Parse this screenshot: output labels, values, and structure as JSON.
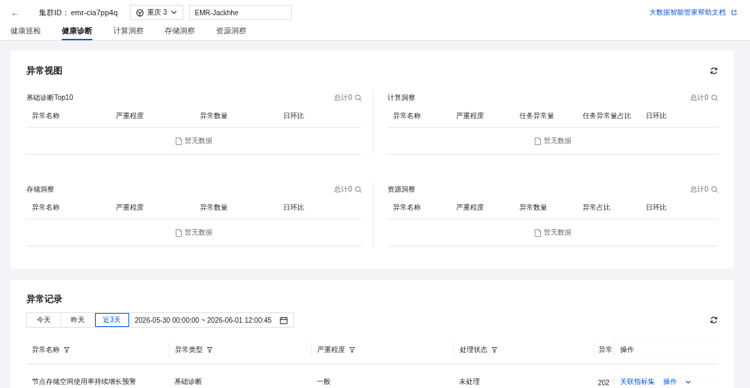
{
  "header": {
    "back": "←",
    "cluster_label": "集群ID：",
    "cluster_id": "emr-cia7pp4q",
    "region": "重庆 3",
    "cluster_name": "EMR-Jackhhe",
    "help_link": "大数据智能管家帮助文档"
  },
  "tabs": [
    {
      "label": "健康巡检",
      "selected": false
    },
    {
      "label": "健康诊断",
      "selected": true
    },
    {
      "label": "计算洞察",
      "selected": false
    },
    {
      "label": "存储洞察",
      "selected": false
    },
    {
      "label": "资源洞察",
      "selected": false
    }
  ],
  "overview": {
    "title": "异常视图",
    "panels": [
      {
        "title": "基础诊断Top10",
        "total": "总计0",
        "columns": [
          "异常名称",
          "严重程度",
          "异常数量",
          "日环比"
        ],
        "empty": "暂无数据"
      },
      {
        "title": "计算洞察",
        "total": "总计0",
        "columns": [
          "异常名称",
          "严重程度",
          "任务异常量",
          "任务异常量占比",
          "日环比"
        ],
        "empty": "暂无数据"
      },
      {
        "title": "存储洞察",
        "total": "总计0",
        "columns": [
          "异常名称",
          "严重程度",
          "异常数量",
          "日环比"
        ],
        "empty": "暂无数据"
      },
      {
        "title": "资源洞察",
        "total": "总计0",
        "columns": [
          "异常名称",
          "严重程度",
          "异常数量",
          "异常占比",
          "日环比"
        ],
        "empty": "暂无数据"
      }
    ]
  },
  "records": {
    "title": "异常记录",
    "ranges": [
      {
        "label": "今天",
        "selected": false
      },
      {
        "label": "昨天",
        "selected": false
      },
      {
        "label": "近3天",
        "selected": true
      }
    ],
    "date_range": "2026-05-30 00:00:00 ~ 2026-06-01 12:00:45",
    "columns": [
      {
        "label": "异常名称",
        "filter": true
      },
      {
        "label": "异常类型",
        "filter": true
      },
      {
        "label": "严重程度",
        "filter": true
      },
      {
        "label": "处理状态",
        "filter": true
      },
      {
        "label": "异常",
        "filter": false
      },
      {
        "label": "操作",
        "filter": false
      }
    ],
    "rows": [
      {
        "cells": [
          "节点存储空间使用率持续增长预警",
          "基础诊断",
          "一般",
          "未处理",
          "202"
        ],
        "actions": [
          "关联指标集",
          "操作"
        ]
      }
    ]
  }
}
